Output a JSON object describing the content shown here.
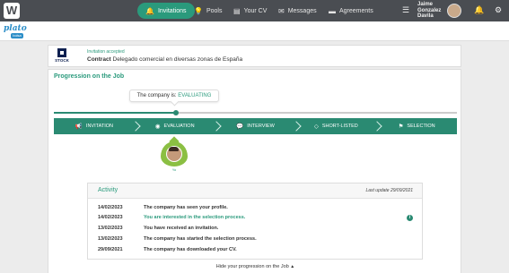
{
  "topbar": {
    "brand": "W",
    "nav": [
      {
        "label": "Invitations",
        "icon": "bell-icon",
        "glyph": "🔔",
        "active": true
      },
      {
        "label": "Pools",
        "icon": "lightbulb-icon",
        "glyph": "💡",
        "active": false
      },
      {
        "label": "Your CV",
        "icon": "cv-icon",
        "glyph": "▤",
        "active": false
      },
      {
        "label": "Messages",
        "icon": "chat-icon",
        "glyph": "✉",
        "active": false
      },
      {
        "label": "Agreements",
        "icon": "folder-icon",
        "glyph": "▬",
        "active": false
      }
    ],
    "user_name": "Jaime Gonzalez Davila"
  },
  "subbar": {
    "logo_text": "plato",
    "logo_badge": "bolsa"
  },
  "offer": {
    "company_logo_text": "STOCK",
    "status": "Invitation accepted",
    "contract_label": "Contract",
    "contract_title": "Delegado comercial en diversas zonas de España"
  },
  "progression": {
    "title": "Progression on the Job",
    "status_prefix": "The company is:",
    "status_value": "EVALUATING",
    "progress": 0.302,
    "steps": [
      {
        "label": "INVITATION",
        "icon": "megaphone-icon",
        "glyph": "📢"
      },
      {
        "label": "EVALUATION",
        "icon": "eye-icon",
        "glyph": "◉"
      },
      {
        "label": "INTERVIEW",
        "icon": "chat-bubble-icon",
        "glyph": "💬"
      },
      {
        "label": "SHORT-LISTED",
        "icon": "diamond-icon",
        "glyph": "◇"
      },
      {
        "label": "SELECTION",
        "icon": "flag-icon",
        "glyph": "⚑"
      }
    ],
    "candidate_caption": "Yo"
  },
  "activity": {
    "title": "Activity",
    "last_update": "Last update 29/09/2021",
    "entries": [
      {
        "date": "14/02/2023",
        "text": "The company has seen your profile.",
        "highlight": false
      },
      {
        "date": "14/02/2023",
        "text": "You are interested in the selection process.",
        "highlight": true
      },
      {
        "date": "13/02/2023",
        "text": "You have received an invitation.",
        "highlight": false
      },
      {
        "date": "13/02/2023",
        "text": "The company has started the selection process.",
        "highlight": false
      },
      {
        "date": "29/09/2021",
        "text": "The company has downloaded your CV.",
        "highlight": false
      }
    ]
  },
  "footer": {
    "hide_label": "Hide your progression on the Job"
  },
  "colors": {
    "accent": "#2a8a72",
    "topbar": "#4a4d52",
    "leaf": "#8bbf43"
  }
}
